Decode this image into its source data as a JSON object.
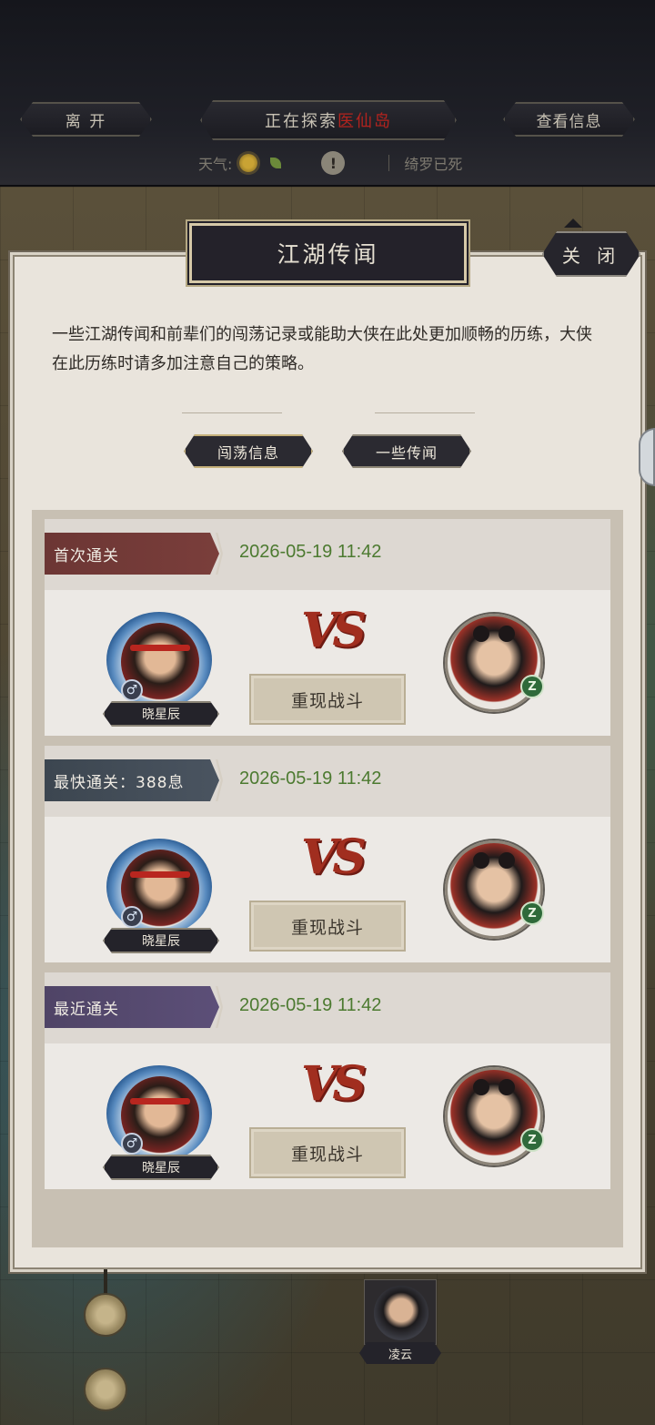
{
  "topbar": {
    "leave_label": "离 开",
    "exploring_prefix": "正在探索",
    "exploring_place": "医仙岛",
    "info_label": "查看信息",
    "weather_label": "天气:",
    "status_text": "绮罗已死"
  },
  "panel": {
    "title": "江湖传闻",
    "close_label": "关 闭",
    "description": "一些江湖传闻和前辈们的闯荡记录或能助大侠在此处更加顺畅的历练，大侠在此历练时请多加注意自己的策略。",
    "tabs": [
      {
        "label": "闯荡信息",
        "active": true
      },
      {
        "label": "一些传闻",
        "active": false
      }
    ]
  },
  "records": [
    {
      "tag": "首次通关",
      "date": "2026-05-19 11:42",
      "hero_name": "晓星辰",
      "gender": "♂",
      "vs": "VS",
      "replay_label": "重现战斗",
      "enemy_badge": "Z"
    },
    {
      "tag": "最快通关：388息",
      "date": "2026-05-19 11:42",
      "hero_name": "晓星辰",
      "gender": "♂",
      "vs": "VS",
      "replay_label": "重现战斗",
      "enemy_badge": "Z"
    },
    {
      "tag": "最近通关",
      "date": "2026-05-19 11:42",
      "hero_name": "晓星辰",
      "gender": "♂",
      "vs": "VS",
      "replay_label": "重现战斗",
      "enemy_badge": "Z"
    }
  ],
  "bottom": {
    "avatar_name": "凌云"
  },
  "colors": {
    "place_red": "#b3231e",
    "date_green": "#4c7a30",
    "ribbon_red": "#6c3634",
    "ribbon_slate": "#3c4650",
    "ribbon_purple": "#4f4466"
  }
}
